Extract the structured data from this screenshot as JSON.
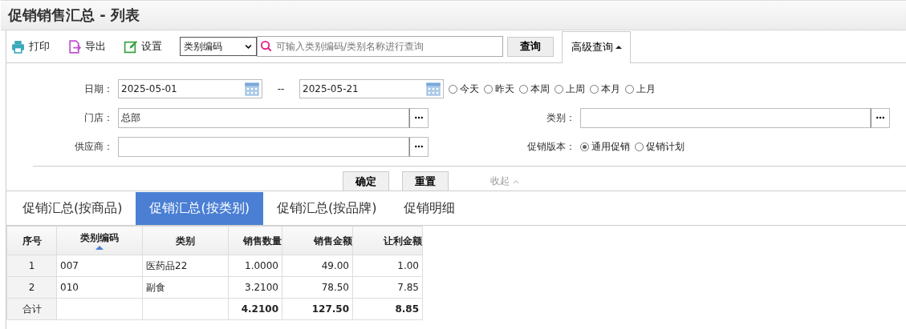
{
  "window": {
    "title": "促销销售汇总 - 列表"
  },
  "toolbar": {
    "buttons": [
      {
        "label": "打印",
        "kind": "print"
      },
      {
        "label": "导出",
        "kind": "export"
      },
      {
        "label": "设置",
        "kind": "settings"
      }
    ],
    "search_type": {
      "value": "类别编码"
    },
    "search": {
      "placeholder": "可输入类别编码/类别名称进行查询"
    },
    "query_button": "查询",
    "advanced_toggle": {
      "label": "高级查询",
      "expanded": true
    }
  },
  "filters": {
    "date": {
      "label": "日期：",
      "from": "2025-05-01",
      "separator": "--",
      "to": "2025-05-21"
    },
    "quick_dates": [
      {
        "label": "今天",
        "selected": false
      },
      {
        "label": "昨天",
        "selected": false
      },
      {
        "label": "本周",
        "selected": false
      },
      {
        "label": "上周",
        "selected": false
      },
      {
        "label": "本月",
        "selected": false
      },
      {
        "label": "上月",
        "selected": false
      }
    ],
    "store": {
      "label": "门店：",
      "value": "总部"
    },
    "category": {
      "label": "类别："
    },
    "supplier": {
      "label": "供应商："
    },
    "promo_version": {
      "label": "促销版本：",
      "options": [
        {
          "label": "通用促销",
          "selected": true
        },
        {
          "label": "促销计划",
          "selected": false
        }
      ]
    },
    "buttons": [
      "确定",
      "重置"
    ],
    "collapse": "收起"
  },
  "tabs": [
    {
      "label": "促销汇总(按商品)",
      "selected": false
    },
    {
      "label": "促销汇总(按类别)",
      "selected": true
    },
    {
      "label": "促销汇总(按品牌)",
      "selected": false
    },
    {
      "label": "促销明细",
      "selected": false
    }
  ],
  "table": {
    "columns": [
      {
        "label": "序号",
        "sorted": false
      },
      {
        "label": "类别编码",
        "sorted": true
      },
      {
        "label": "类别",
        "sorted": false
      },
      {
        "label": "销售数量",
        "sorted": false
      },
      {
        "label": "销售金额",
        "sorted": false
      },
      {
        "label": "让利金额",
        "sorted": false
      }
    ],
    "rows": [
      [
        "1",
        "007",
        "医药品22",
        "1.0000",
        "49.00",
        "1.00"
      ],
      [
        "2",
        "010",
        "副食",
        "3.2100",
        "78.50",
        "7.85"
      ]
    ],
    "total": {
      "label": "合计",
      "sales_quantity": "4.2100",
      "sales_amount": "127.50",
      "discount_amount": "8.85"
    }
  }
}
